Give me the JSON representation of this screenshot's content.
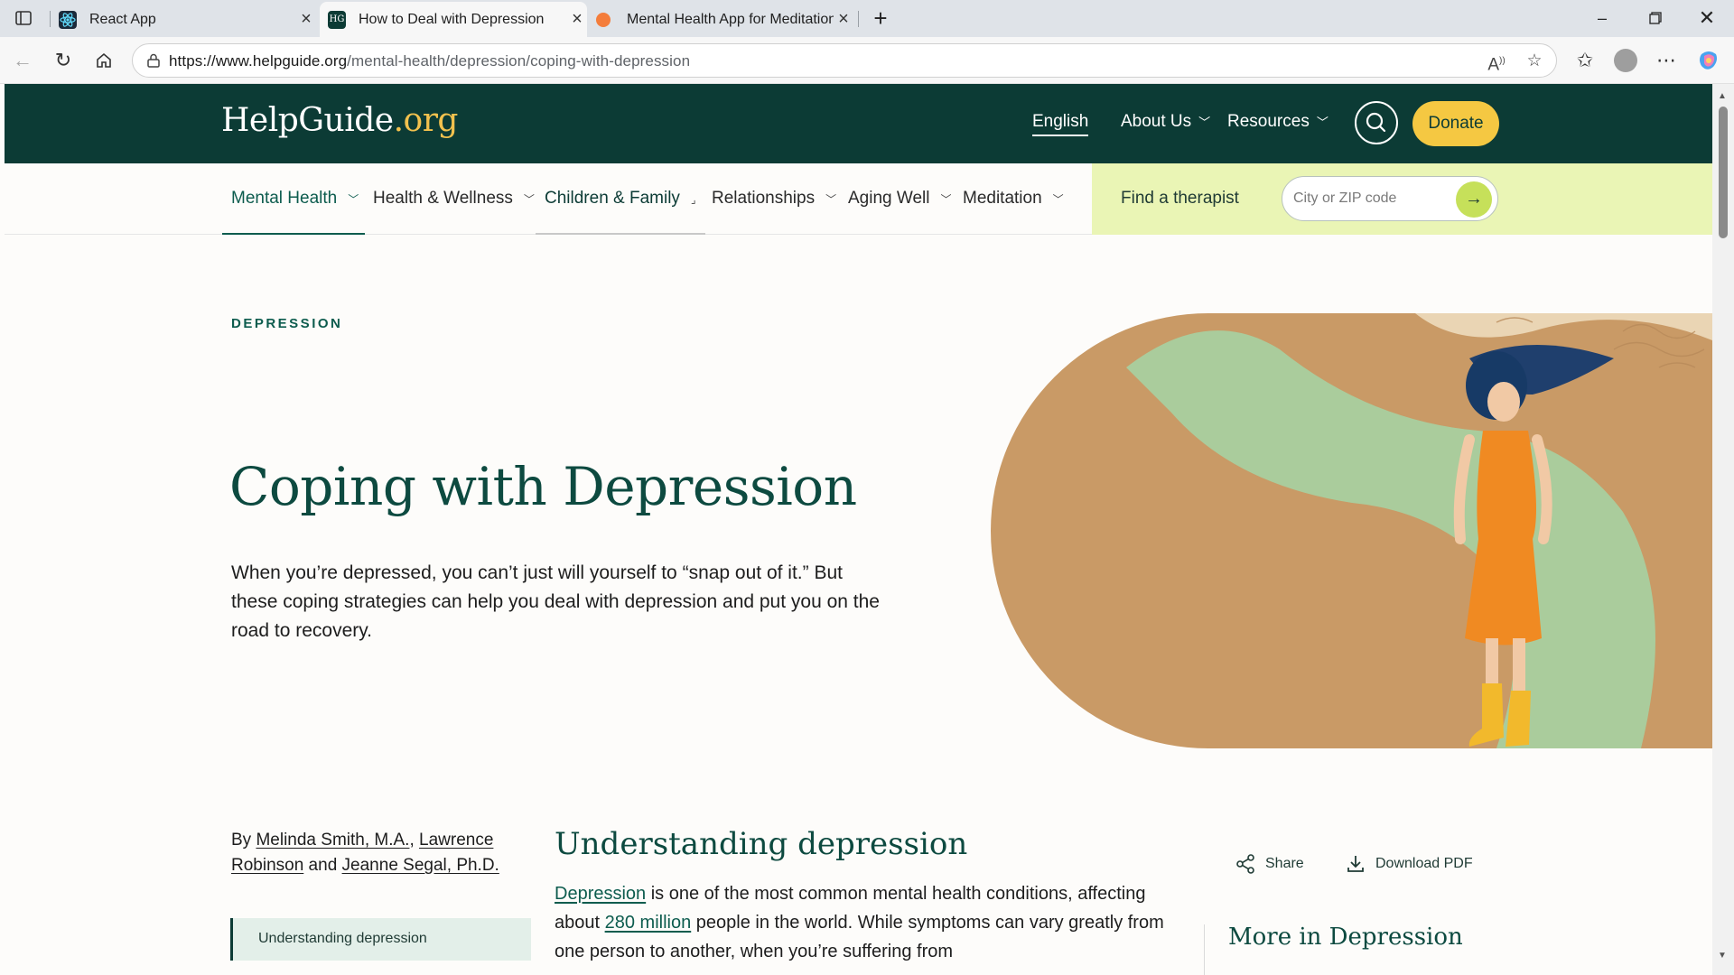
{
  "browser": {
    "tabs": [
      {
        "title": "React App",
        "active": false
      },
      {
        "title": "How to Deal with Depression",
        "active": true
      },
      {
        "title": "Mental Health App for Meditation",
        "active": false
      }
    ],
    "new_tab_label": "+",
    "url_host": "https://www.helpguide.org",
    "url_path": "/mental-health/depression/coping-with-depression"
  },
  "header": {
    "logo_main": "HelpGuide",
    "logo_suffix": ".org",
    "language": "English",
    "about": "About Us",
    "resources": "Resources",
    "donate": "Donate"
  },
  "subnav": {
    "items": [
      {
        "label": "Mental Health"
      },
      {
        "label": "Health & Wellness"
      },
      {
        "label": "Children & Family"
      },
      {
        "label": "Relationships"
      },
      {
        "label": "Aging Well"
      },
      {
        "label": "Meditation"
      }
    ],
    "therapist_label": "Find a therapist",
    "zip_placeholder": "City or ZIP code"
  },
  "hero": {
    "eyebrow": "DEPRESSION",
    "title": "Coping with Depression",
    "lead": "When you’re depressed, you can’t just will yourself to “snap out of it.” But these coping strategies can help you deal with depression and put you on the road to recovery."
  },
  "article": {
    "byline_prefix": "By ",
    "author1": "Melinda Smith, M.A.",
    "sep1": ", ",
    "author2": "Lawrence Robinson",
    "sep2": " and ",
    "author3": "Jeanne Segal, Ph.D.",
    "toc_item": "Understanding depression",
    "section_title": "Understanding depression",
    "body_link1": "Depression",
    "body_text1": " is one of the most common mental health conditions, affecting about ",
    "body_link2": "280 million",
    "body_text2": " people in the world. While symptoms can vary greatly from one person to another, when you’re suffering from",
    "share": "Share",
    "download": "Download PDF",
    "more_title": "More in Depression"
  },
  "colors": {
    "brand_dark": "#0c3b35",
    "accent_yellow": "#f5c842",
    "therapist_bg": "#eaf5b5",
    "heading_green": "#0d4a40"
  }
}
